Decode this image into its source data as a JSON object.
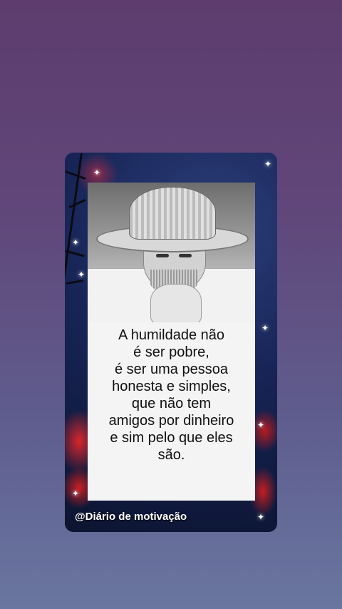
{
  "card": {
    "quote_lines": [
      "A humildade não",
      "é ser pobre,",
      "é ser uma pessoa",
      "honesta e simples,",
      "que não tem",
      "amigos por dinheiro",
      "e sim pelo que eles",
      "são."
    ],
    "handle": "@Diário de motivação",
    "photo_subject": "elderly-man-straw-hat"
  },
  "colors": {
    "background_top": "#5e3c6e",
    "background_bottom": "#6a76a0",
    "card_background": "#172456",
    "text_box": "#f4f4f4",
    "accent_red": "#d7262a"
  }
}
